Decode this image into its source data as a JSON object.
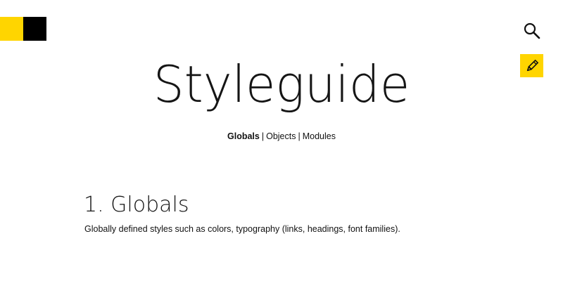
{
  "logo": {
    "colors": [
      "#FFD500",
      "#000000"
    ]
  },
  "header": {
    "search_icon": "search-icon",
    "edit_icon": "pencil-icon",
    "accent_color": "#FFD500"
  },
  "title": "Styleguide",
  "subnav": {
    "items": [
      {
        "label": "Globals",
        "active": true
      },
      {
        "label": "Objects",
        "active": false
      },
      {
        "label": "Modules",
        "active": false
      }
    ],
    "separator": "|"
  },
  "section": {
    "heading": "1. Globals",
    "description": "Globally defined styles such as colors, typography (links, headings, font families)."
  }
}
